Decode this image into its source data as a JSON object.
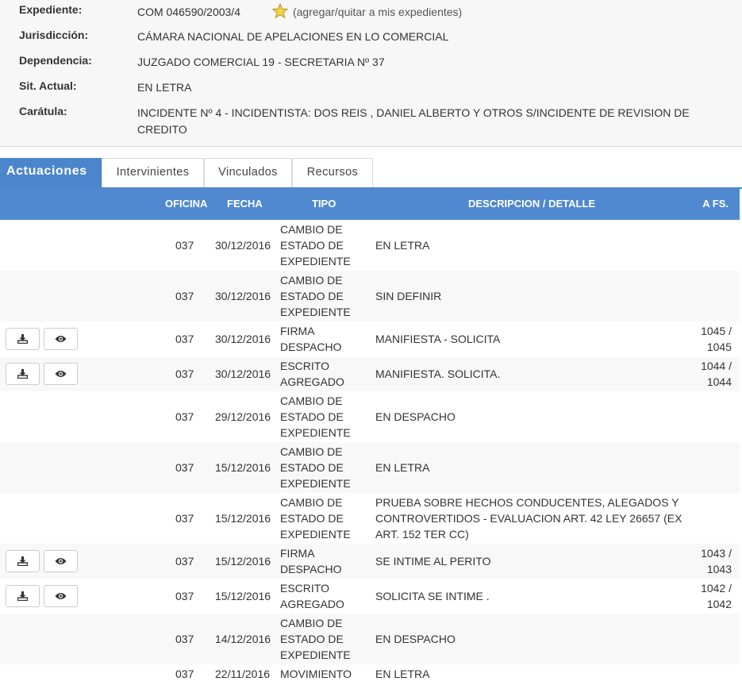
{
  "expediente": {
    "label": "Expediente:",
    "value": "COM 046590/2003/4",
    "fav_text": "(agregar/quitar a mis expedientes)"
  },
  "jurisdiccion": {
    "label": "Jurisdicción:",
    "value": "CÁMARA NACIONAL DE APELACIONES EN LO COMERCIAL"
  },
  "dependencia": {
    "label": "Dependencia:",
    "value": "JUZGADO COMERCIAL 19 - SECRETARIA Nº 37"
  },
  "situacion": {
    "label": "Sit. Actual:",
    "value": "EN LETRA"
  },
  "caratula": {
    "label": "Carátula:",
    "value": "INCIDENTE Nº 4 - INCIDENTISTA: DOS REIS , DANIEL ALBERTO Y OTROS S/INCIDENTE DE REVISION DE CREDITO"
  },
  "tabs": [
    "Actuaciones",
    "Intervinientes",
    "Vinculados",
    "Recursos"
  ],
  "table": {
    "headers": {
      "oficina": "OFICINA",
      "fecha": "FECHA",
      "tipo": "TIPO",
      "descripcion": "DESCRIPCION / DETALLE",
      "fs": "A FS."
    },
    "rows": [
      {
        "oficina": "037",
        "fecha": "30/12/2016",
        "tipo": "CAMBIO DE ESTADO DE EXPEDIENTE",
        "descripcion": "EN LETRA",
        "fs": ""
      },
      {
        "oficina": "037",
        "fecha": "30/12/2016",
        "tipo": "CAMBIO DE ESTADO DE EXPEDIENTE",
        "descripcion": "SIN DEFINIR",
        "fs": ""
      },
      {
        "oficina": "037",
        "fecha": "30/12/2016",
        "tipo": "FIRMA DESPACHO",
        "descripcion": "MANIFIESTA - SOLICITA",
        "fs": "1045 / 1045"
      },
      {
        "oficina": "037",
        "fecha": "30/12/2016",
        "tipo": "ESCRITO AGREGADO",
        "descripcion": "MANIFIESTA. SOLICITA.",
        "fs": "1044 / 1044"
      },
      {
        "oficina": "037",
        "fecha": "29/12/2016",
        "tipo": "CAMBIO DE ESTADO DE EXPEDIENTE",
        "descripcion": "EN DESPACHO",
        "fs": ""
      },
      {
        "oficina": "037",
        "fecha": "15/12/2016",
        "tipo": "CAMBIO DE ESTADO DE EXPEDIENTE",
        "descripcion": "EN LETRA",
        "fs": ""
      },
      {
        "oficina": "037",
        "fecha": "15/12/2016",
        "tipo": "CAMBIO DE ESTADO DE EXPEDIENTE",
        "descripcion": "PRUEBA SOBRE HECHOS CONDUCENTES, ALEGADOS Y CONTROVERTIDOS - EVALUACION ART. 42 LEY 26657 (EX ART. 152 TER CC)",
        "fs": ""
      },
      {
        "oficina": "037",
        "fecha": "15/12/2016",
        "tipo": "FIRMA DESPACHO",
        "descripcion": "SE INTIME AL PERITO",
        "fs": "1043 / 1043"
      },
      {
        "oficina": "037",
        "fecha": "15/12/2016",
        "tipo": "ESCRITO AGREGADO",
        "descripcion": "SOLICITA SE INTIME .",
        "fs": "1042 / 1042"
      },
      {
        "oficina": "037",
        "fecha": "14/12/2016",
        "tipo": "CAMBIO DE ESTADO DE EXPEDIENTE",
        "descripcion": "EN DESPACHO",
        "fs": ""
      },
      {
        "oficina": "037",
        "fecha": "22/11/2016",
        "tipo": "MOVIMIENTO",
        "descripcion": "EN LETRA",
        "fs": ""
      }
    ]
  },
  "icons": {
    "download": "download-icon",
    "view": "eye-icon",
    "favorite": "star-icon"
  },
  "colors": {
    "accent": "#5089cf",
    "tab_active": "#4b86cc"
  }
}
